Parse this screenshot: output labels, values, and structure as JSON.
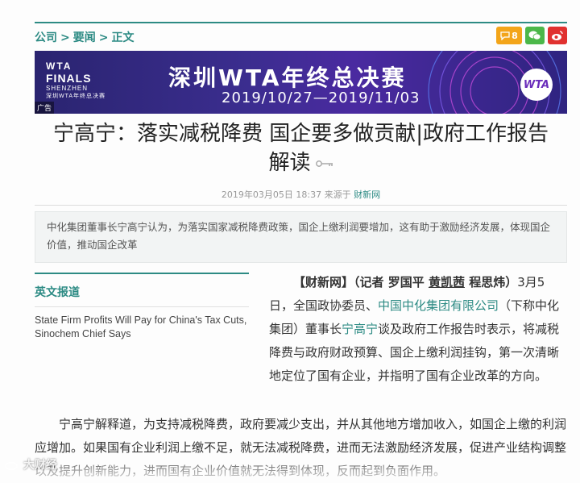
{
  "breadcrumb": {
    "item1": "公司",
    "sep": ">",
    "item2": "要闻",
    "item3": "正文"
  },
  "share": {
    "comment_count": "8",
    "comment_icon": "comment-icon",
    "wechat_icon": "wechat-icon",
    "weibo_icon": "weibo-icon"
  },
  "banner": {
    "logo_wta": "WTA",
    "logo_finals": "FINALS",
    "logo_city": "SHENZHEN",
    "logo_sub": "深圳WTA年终总决赛",
    "title": "深圳WTA年终总决赛",
    "dates": "2019/10/27—2019/11/03",
    "badge": "WTA",
    "ad_label": "广告"
  },
  "article": {
    "headline_line1": "宁高宁：落实减税降费 国企要多做贡献|政府工作报告",
    "headline_line2": "解读",
    "date": "2019年03月05日 18:37",
    "source_prefix": "来源于",
    "source": "财新网",
    "summary": "中化集团董事长宁高宁认为，为落实国家减税降费政策，国企上缴利润要增加，这有助于激励经济发展，体现国企价值，推动国企改革",
    "lead_bold": "【财新网】（记者 罗国平 ",
    "lead_reporter_link": "黄凯茜",
    "lead_bold_end": " 程思炜）",
    "p1_a": "3月5日，全国政协委员、",
    "p1_link1": "中国中化集团有限公司",
    "p1_b": "（下称中化集团）董事长",
    "p1_link2": "宁高宁",
    "p1_c": "谈及政府工作报告时表示，将减税降费与政府财政预算、国企上缴利润挂钩，第一次清晰地定位了国有企业，并指明了国有企业改革的方向。",
    "p2": "宁高宁解释道，为支持减税降费，政府要减少支出，并从其他地方增加收入，如国企上缴的利润应增加。如果国有企业利润上缴不足，就无法减税降费，进而无法激励经济发展，促进产业结构调整以及提升创新能力，进而国有企业价值就无法得到体现，反而起到负面作用。"
  },
  "sidebar": {
    "title": "英文报道",
    "link": "State Firm Profits Will Pay for China's Tax Cuts, Sinochem Chief Says"
  },
  "watermark": "大财经"
}
